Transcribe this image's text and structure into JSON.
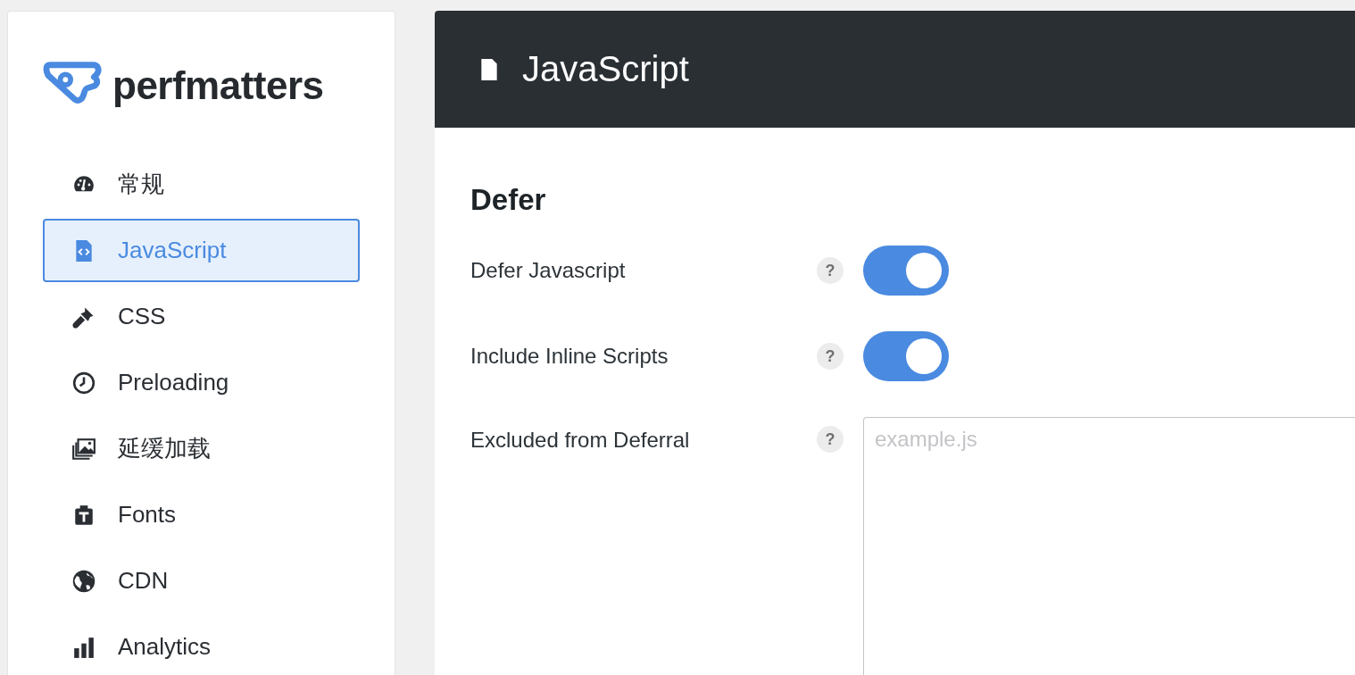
{
  "logo": {
    "text": "perfmatters"
  },
  "sidebar": {
    "items": [
      {
        "label": "常规",
        "selected": false
      },
      {
        "label": "JavaScript",
        "selected": true
      },
      {
        "label": "CSS",
        "selected": false
      },
      {
        "label": "Preloading",
        "selected": false
      },
      {
        "label": "延缓加载",
        "selected": false
      },
      {
        "label": "Fonts",
        "selected": false
      },
      {
        "label": "CDN",
        "selected": false
      },
      {
        "label": "Analytics",
        "selected": false
      }
    ]
  },
  "header": {
    "title": "JavaScript"
  },
  "section": {
    "title": "Defer",
    "settings": [
      {
        "kind": "toggle",
        "label": "Defer Javascript",
        "help": "?",
        "on": true
      },
      {
        "kind": "toggle",
        "label": "Include Inline Scripts",
        "help": "?",
        "on": true
      },
      {
        "kind": "textarea",
        "label": "Excluded from Deferral",
        "help": "?",
        "placeholder": "example.js"
      }
    ]
  }
}
